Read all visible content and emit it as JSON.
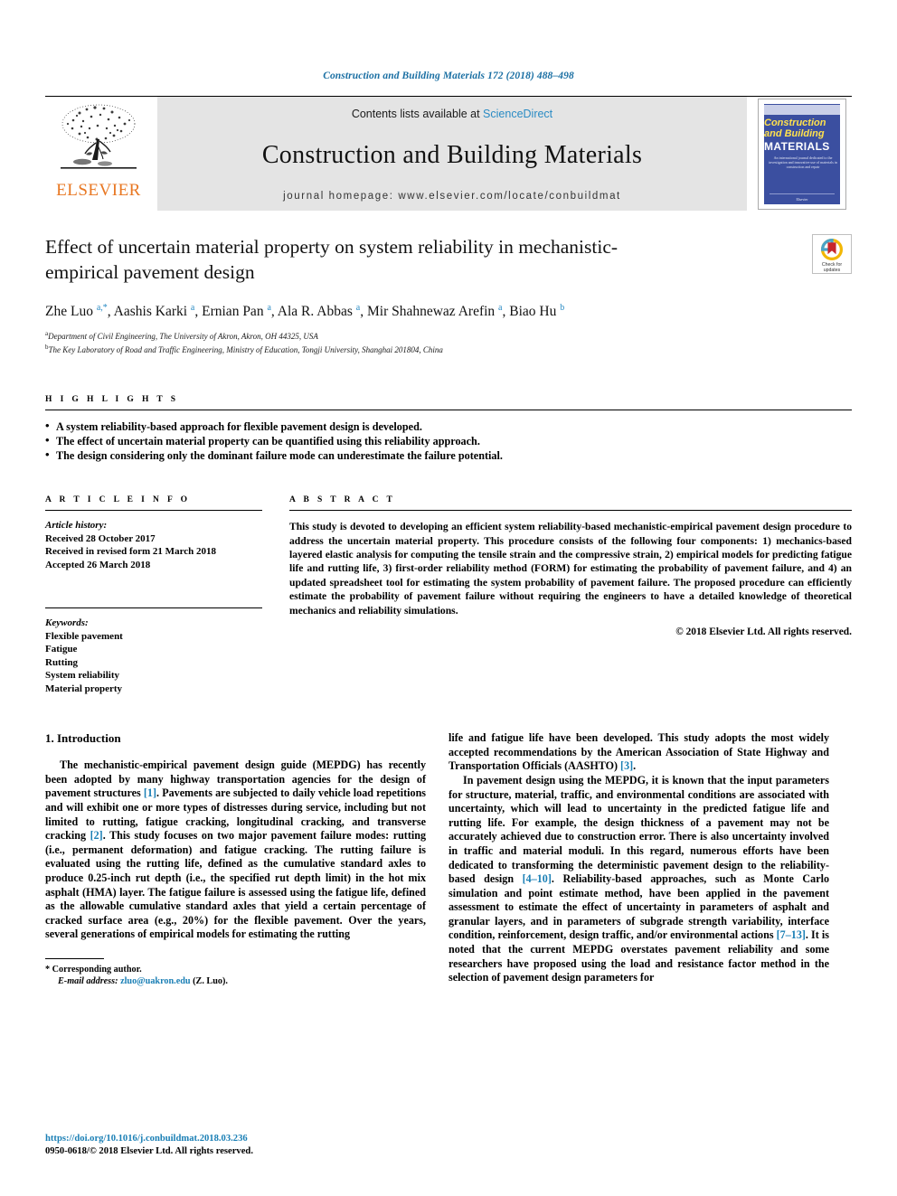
{
  "running_head": "Construction and Building Materials 172 (2018) 488–498",
  "masthead": {
    "publisher": "ELSEVIER",
    "contents_prefix": "Contents lists available at ",
    "contents_link": "ScienceDirect",
    "journal_name": "Construction and Building Materials",
    "homepage": "journal homepage: www.elsevier.com/locate/conbuildmat",
    "cover": {
      "line1": "Construction",
      "line2": "and Building",
      "line3": "MATERIALS",
      "blurb": "An international journal dedicated to the investigation and innovative use of materials in construction and repair",
      "foot": "Elsevier"
    }
  },
  "article": {
    "title": "Effect of uncertain material property on system reliability in mechanistic-empirical pavement design",
    "authors_html": "Zhe Luo <sup>a,*</sup>, Aashis Karki <sup>a</sup>, Ernian Pan <sup>a</sup>, Ala R. Abbas <sup>a</sup>, Mir Shahnewaz Arefin <sup>a</sup>, Biao Hu <sup>b</sup>",
    "affiliations": [
      "Department of Civil Engineering, The University of Akron, Akron, OH 44325, USA",
      "The Key Laboratory of Road and Traffic Engineering, Ministry of Education, Tongji University, Shanghai 201804, China"
    ],
    "affiliation_marks": [
      "a",
      "b"
    ],
    "crossmark_label_line1": "Check for",
    "crossmark_label_line2": "updates"
  },
  "highlights": {
    "heading": "H I G H L I G H T S",
    "items": [
      "A system reliability-based approach for flexible pavement design is developed.",
      "The effect of uncertain material property can be quantified using this reliability approach.",
      "The design considering only the dominant failure mode can underestimate the failure potential."
    ]
  },
  "article_info": {
    "heading": "A R T I C L E   I N F O",
    "history_label": "Article history:",
    "history": [
      "Received 28 October 2017",
      "Received in revised form 21 March 2018",
      "Accepted 26 March 2018"
    ],
    "keywords_label": "Keywords:",
    "keywords": [
      "Flexible pavement",
      "Fatigue",
      "Rutting",
      "System reliability",
      "Material property"
    ]
  },
  "abstract": {
    "heading": "A B S T R A C T",
    "text": "This study is devoted to developing an efficient system reliability-based mechanistic-empirical pavement design procedure to address the uncertain material property. This procedure consists of the following four components: 1) mechanics-based layered elastic analysis for computing the tensile strain and the compressive strain, 2) empirical models for predicting fatigue life and rutting life, 3) first-order reliability method (FORM) for estimating the probability of pavement failure, and 4) an updated spreadsheet tool for estimating the system probability of pavement failure. The proposed procedure can efficiently estimate the probability of pavement failure without requiring the engineers to have a detailed knowledge of theoretical mechanics and reliability simulations.",
    "copyright": "© 2018 Elsevier Ltd. All rights reserved."
  },
  "body": {
    "section_title": "1. Introduction",
    "left_paragraph_1_a": "The mechanistic-empirical pavement design guide (MEPDG) has recently been adopted by many highway transportation agencies for the design of pavement structures ",
    "left_ref_1": "[1]",
    "left_paragraph_1_b": ". Pavements are subjected to daily vehicle load repetitions and will exhibit one or more types of distresses during service, including but not limited to rutting, fatigue cracking, longitudinal cracking, and transverse cracking ",
    "left_ref_2": "[2]",
    "left_paragraph_1_c": ". This study focuses on two major pavement failure modes: rutting (i.e., permanent deformation) and fatigue cracking. The rutting failure is evaluated using the rutting life, defined as the cumulative standard axles to produce 0.25-inch rut depth (i.e., the specified rut depth limit) in the hot mix asphalt (HMA) layer. The fatigue failure is assessed using the fatigue life, defined as the allowable cumulative standard axles that yield a certain percentage of cracked surface area (e.g., 20%) for the flexible pavement. Over the years, several generations of empirical models for estimating the rutting",
    "right_paragraph_1_a": "life and fatigue life have been developed. This study adopts the most widely accepted recommendations by the American Association of State Highway and Transportation Officials (AASHTO) ",
    "right_ref_3": "[3]",
    "right_paragraph_1_b": ".",
    "right_paragraph_2_a": "In pavement design using the MEPDG, it is known that the input parameters for structure, material, traffic, and environmental conditions are associated with uncertainty, which will lead to uncertainty in the predicted fatigue life and rutting life. For example, the design thickness of a pavement may not be accurately achieved due to construction error. There is also uncertainty involved in traffic and material moduli. In this regard, numerous efforts have been dedicated to transforming the deterministic pavement design to the reliability-based design ",
    "right_ref_4": "[4–10]",
    "right_paragraph_2_b": ". Reliability-based approaches, such as Monte Carlo simulation and point estimate method, have been applied in the pavement assessment to estimate the effect of uncertainty in parameters of asphalt and granular layers, and in parameters of subgrade strength variability, interface condition, reinforcement, design traffic, and/or environmental actions ",
    "right_ref_5": "[7–13]",
    "right_paragraph_2_c": ". It is noted that the current MEPDG overstates pavement reliability and some researchers have proposed using the load and resistance factor method in the selection of pavement design parameters for"
  },
  "footnote": {
    "corresponding": "* Corresponding author.",
    "email_label": "E-mail address:",
    "email": "zluo@uakron.edu",
    "email_suffix": "(Z. Luo)."
  },
  "page_footer": {
    "doi": "https://doi.org/10.1016/j.conbuildmat.2018.03.236",
    "issn": "0950-0618/© 2018 Elsevier Ltd. All rights reserved."
  },
  "colors": {
    "link": "#1a7fb5",
    "sciencedirect": "#2a8bc4",
    "elsevier_orange": "#E87722",
    "running_head": "#1a6fa3",
    "cover_blue": "#3b4fa0"
  }
}
